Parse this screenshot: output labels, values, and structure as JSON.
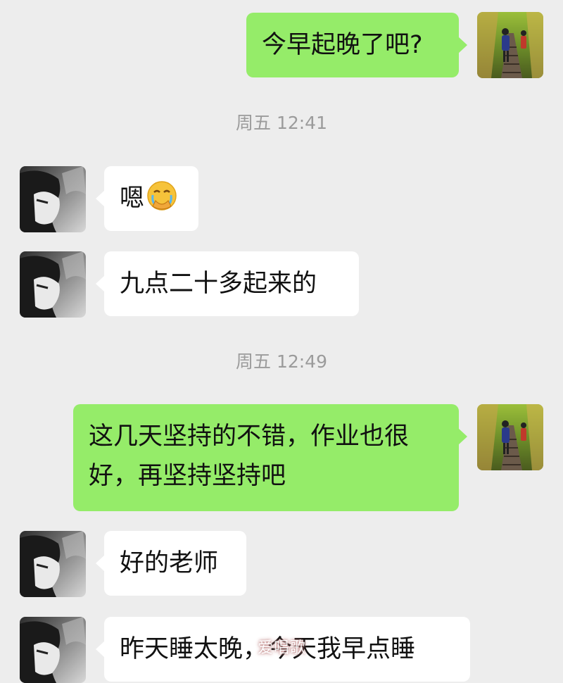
{
  "messages": [
    {
      "side": "right",
      "text": "今早起晚了吧?"
    },
    {
      "type": "timestamp",
      "text": "周五 12:41"
    },
    {
      "side": "left",
      "text": "嗯",
      "emoji": "face-with-hand-over-mouth-crying-emoji"
    },
    {
      "side": "left",
      "text": "九点二十多起来的"
    },
    {
      "type": "timestamp",
      "text": "周五 12:49"
    },
    {
      "side": "right",
      "text": "这几天坚持的不错，作业也很好，再坚持坚持吧"
    },
    {
      "side": "left",
      "text": "好的老师"
    },
    {
      "side": "left",
      "text": "昨天睡太晚，今天我早点睡"
    }
  ],
  "watermark": "爱唱歌",
  "colors": {
    "background": "#ededed",
    "bubble_self": "#95ec69",
    "bubble_other": "#ffffff",
    "timestamp": "#9b9b9b"
  },
  "icons": {
    "self_avatar": "railway-walk-painting-avatar",
    "other_avatar": "anime-boy-sketch-avatar"
  }
}
